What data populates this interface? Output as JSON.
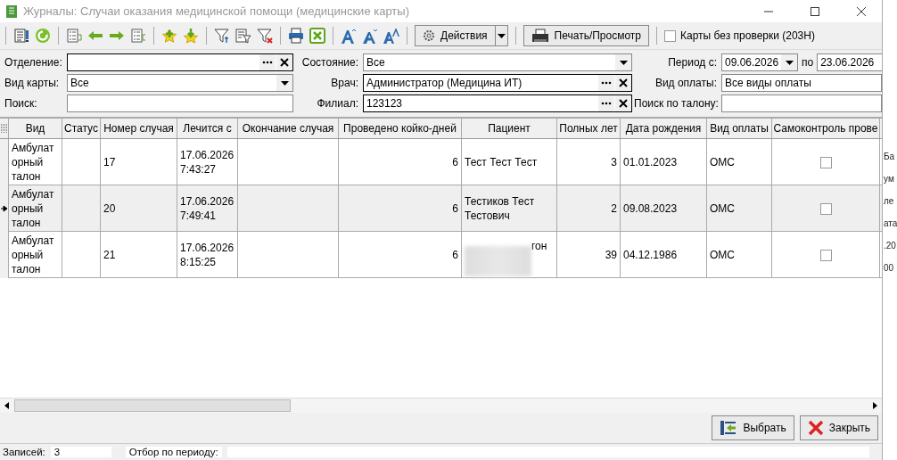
{
  "window": {
    "title": "Журналы: Случаи оказания медицинской помощи (медицинские карты)"
  },
  "toolbar": {
    "buttons": [
      {
        "kind": "menu",
        "label": "Действия"
      },
      {
        "kind": "print",
        "label": "Печать/Просмотр"
      }
    ],
    "checkbox": {
      "label": "Карты без проверки (203Н)",
      "checked": false
    }
  },
  "filters": [
    {
      "label": "Отделение:",
      "kind": "lookup"
    },
    {
      "label": "Состояние:",
      "kind": "combo",
      "value": "Все"
    },
    {
      "label": "Период с:",
      "kind": "range",
      "value": "09.06.2026",
      "to_label": "по",
      "to_value": "23.06.2026"
    },
    {
      "label": "Вид карты:",
      "kind": "combo",
      "value": "Все"
    },
    {
      "label": "Врач:",
      "kind": "lookup",
      "value": "Администратор (Медицина ИТ)"
    },
    {
      "label": "Вид оплаты:",
      "kind": "text",
      "value": "Все виды оплаты"
    },
    {
      "label": "Поиск:",
      "kind": "text"
    },
    {
      "label": "Филиал:",
      "kind": "lookup",
      "value": "123123"
    },
    {
      "label": "Поиск по талону:",
      "kind": "text"
    }
  ],
  "table": {
    "columns": [
      "Вид",
      "Статус",
      "Номер случая",
      "Лечится с",
      "Окончание случая",
      "Проведено койко-дней",
      "Пациент",
      "Полных лет",
      "Дата рождения",
      "Вид оплаты",
      "Самоконтроль прове"
    ],
    "rows": [
      {
        "selected": false,
        "vid": "Амбулаторный талон",
        "number": "17",
        "start": "17.06.2026 7:43:27",
        "days": "6",
        "patient": "Тест Тест Тест",
        "patient_blurred": false,
        "age": "3",
        "birth": "01.01.2023",
        "payment": "ОМС",
        "self_check": false
      },
      {
        "selected": true,
        "vid": "Амбулаторный талон",
        "number": "20",
        "start": "17.06.2026 7:49:41",
        "days": "6",
        "patient": "Тестиков Тест Тестович",
        "patient_blurred": false,
        "age": "2",
        "birth": "09.08.2023",
        "payment": "ОМС",
        "self_check": false
      },
      {
        "selected": false,
        "vid": "Амбулаторный талон",
        "number": "21",
        "start": "17.06.2026 8:15:25",
        "days": "6",
        "patient": "гон",
        "patient_blurred": true,
        "age": "39",
        "birth": "04.12.1986",
        "payment": "ОМС",
        "self_check": false
      }
    ]
  },
  "actions": [
    "Выбрать",
    "Закрыть"
  ],
  "status_bar": {
    "records_label": "Записей:",
    "records": "3",
    "period_label": "Отбор по периоду:"
  },
  "background_window": {
    "fragments": [
      "Ба",
      "ум",
      "ле",
      "ата",
      ".20",
      "00"
    ]
  }
}
